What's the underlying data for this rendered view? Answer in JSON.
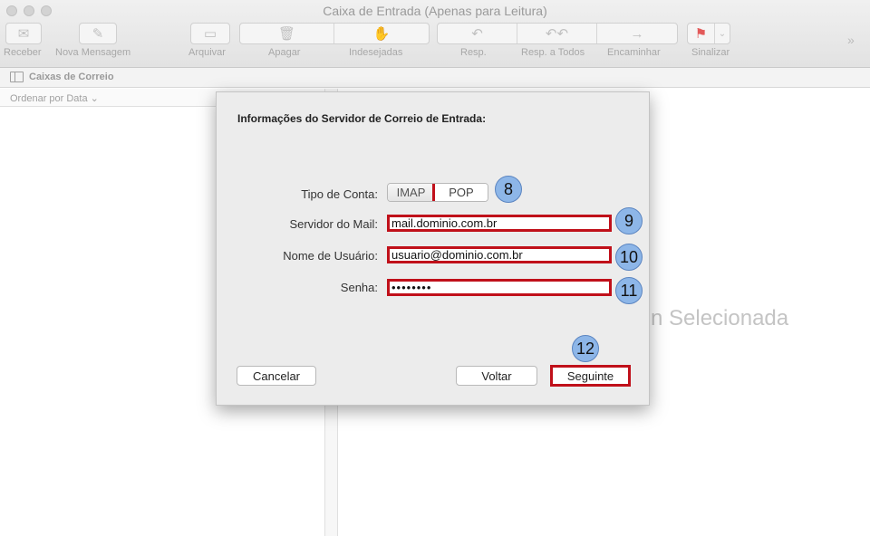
{
  "window": {
    "title": "Caixa de Entrada (Apenas para Leitura)"
  },
  "toolbar": {
    "receive": "Receber",
    "new_message": "Nova Mensagem",
    "archive": "Arquivar",
    "delete": "Apagar",
    "junk": "Indesejadas",
    "reply": "Resp.",
    "reply_all": "Resp. a Todos",
    "forward": "Encaminhar",
    "flag": "Sinalizar",
    "more": "»"
  },
  "mailboxes_bar": {
    "label": "Caixas de Correio"
  },
  "sort": {
    "label": "Ordenar por Data ⌄"
  },
  "viewer": {
    "no_message_text": "n Selecionada"
  },
  "dialog": {
    "title": "Informações do Servidor de Correio de Entrada:",
    "account_type_label": "Tipo de Conta:",
    "account_type_options": [
      "IMAP",
      "POP"
    ],
    "account_type_selected": "POP",
    "mail_server_label": "Servidor do Mail:",
    "mail_server_value": "mail.dominio.com.br",
    "username_label": "Nome de Usuário:",
    "username_value": "usuario@dominio.com.br",
    "password_label": "Senha:",
    "password_value": "••••••••",
    "cancel_button": "Cancelar",
    "back_button": "Voltar",
    "next_button": "Seguinte"
  },
  "steps": {
    "s8": "8",
    "s9": "9",
    "s10": "10",
    "s11": "11",
    "s12": "12"
  },
  "colors": {
    "highlight": "#c0101a",
    "badge": "#8db6e8"
  }
}
